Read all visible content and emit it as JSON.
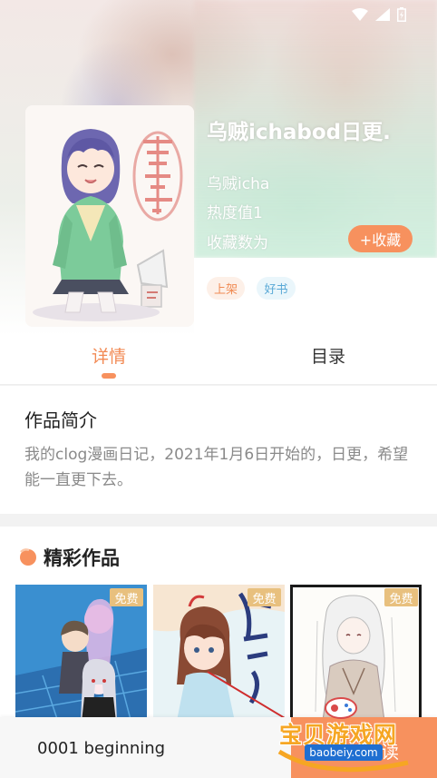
{
  "book": {
    "title": "乌贼ichabod日更.",
    "author": "乌贼icha",
    "heat": "热度值1",
    "favorites": "收藏数为",
    "favorite_button": "+收藏",
    "tags": [
      "上架",
      "好书"
    ]
  },
  "tabs": [
    {
      "label": "详情",
      "active": true
    },
    {
      "label": "目录",
      "active": false
    }
  ],
  "intro": {
    "title": "作品简介",
    "text": "我的clog漫画日记，2021年1月6日开始的，日更，希望能一直更下去。"
  },
  "featured": {
    "title": "精彩作品",
    "items": [
      {
        "badge": "免费"
      },
      {
        "badge": "免费"
      },
      {
        "badge": "免费"
      }
    ]
  },
  "bottom_bar": {
    "chapter": "0001 beginning",
    "read_button": "读"
  },
  "watermark": {
    "text": "宝贝游戏网",
    "url": "baobeiy.com"
  },
  "colors": {
    "accent": "#f7915e",
    "badge": "#e8c07e",
    "tag_shelf": "#f08b54",
    "tag_good": "#5aa9d6"
  },
  "icons": [
    "wifi-icon",
    "signal-icon",
    "battery-icon",
    "featured-section-icon"
  ]
}
